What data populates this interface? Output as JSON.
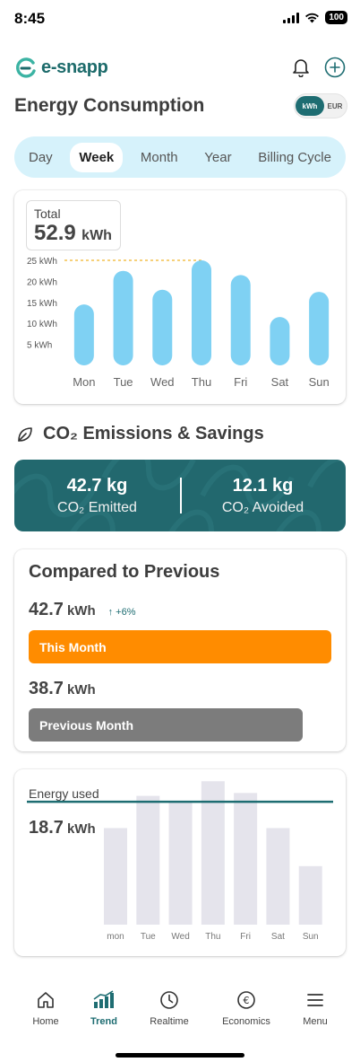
{
  "status": {
    "time": "8:45",
    "battery": "100"
  },
  "header": {
    "logo": "e-snapp"
  },
  "page": {
    "title": "Energy Consumption"
  },
  "unit_toggle": {
    "selected": "kWh",
    "other": "EUR"
  },
  "period_tabs": [
    {
      "label": "Day",
      "active": false
    },
    {
      "label": "Week",
      "active": true
    },
    {
      "label": "Month",
      "active": false
    },
    {
      "label": "Year",
      "active": false
    },
    {
      "label": "Billing Cycle",
      "active": false
    }
  ],
  "weekly": {
    "total_label": "Total",
    "total_value": "52.9",
    "total_unit": "kWh",
    "chart_data": {
      "type": "bar",
      "categories": [
        "Mon",
        "Tue",
        "Wed",
        "Thu",
        "Fri",
        "Sat",
        "Sun"
      ],
      "values": [
        14.5,
        22.5,
        18.0,
        25.0,
        21.5,
        11.5,
        17.5
      ],
      "yticks": [
        "25 kWh",
        "20 kWh",
        "15 kWh",
        "10 kWh",
        "5 kWh"
      ],
      "ytick_values": [
        25,
        20,
        15,
        10,
        5
      ],
      "ylim": [
        0,
        25
      ],
      "max_line": true,
      "bar_color": "#7fd1f3",
      "max_line_color": "#f0b429"
    }
  },
  "co2": {
    "heading": "CO₂ Emissions & Savings",
    "emitted_value": "42.7 kg",
    "emitted_label": "CO₂ Emitted",
    "avoided_value": "12.1 kg",
    "avoided_label": "CO₂ Avoided",
    "card_color": "#22686e"
  },
  "compare": {
    "title": "Compared to Previous",
    "current_value": "42.7",
    "current_unit": "kWh",
    "change": "↑ +6%",
    "this_label": "This Month",
    "previous_value": "38.7",
    "previous_unit": "kWh",
    "previous_label": "Previous Month",
    "this_fraction": 1.0,
    "previous_fraction": 0.906,
    "this_color": "#ff8c00",
    "previous_color": "#7c7c7c"
  },
  "energy_used": {
    "label": "Energy used",
    "value": "18.7",
    "unit": "kWh",
    "chart_data": {
      "type": "bar",
      "categories": [
        "mon",
        "Tue",
        "Wed",
        "Thu",
        "Fri",
        "Sat",
        "Sun"
      ],
      "values": [
        16.5,
        22.0,
        21.0,
        24.5,
        22.5,
        16.5,
        10.0
      ],
      "reference_line": 21.0,
      "ylim": [
        0,
        25
      ],
      "bar_color": "#e5e4ec",
      "line_color": "#1e6d72"
    }
  },
  "bottom_nav": [
    {
      "label": "Home",
      "icon": "home-icon",
      "active": false
    },
    {
      "label": "Trend",
      "icon": "trend-icon",
      "active": true
    },
    {
      "label": "Realtime",
      "icon": "clock-icon",
      "active": false
    },
    {
      "label": "Economics",
      "icon": "euro-icon",
      "active": false
    },
    {
      "label": "Menu",
      "icon": "menu-icon",
      "active": false
    }
  ]
}
